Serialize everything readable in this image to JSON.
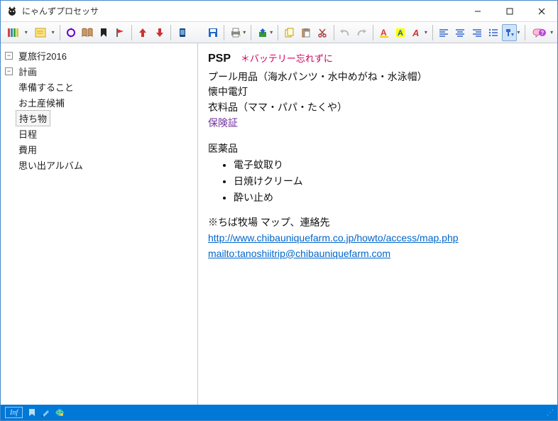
{
  "window": {
    "title": "にゃんずプロセッサ"
  },
  "tree": {
    "root": "夏旅行2016",
    "plan": "計画",
    "plan_children": [
      "準備すること",
      "お土産候補",
      "持ち物"
    ],
    "schedule": "日程",
    "cost": "費用",
    "album": "思い出アルバム",
    "selected": "持ち物"
  },
  "doc": {
    "psp": "PSP",
    "psp_note": "＊バッテリー忘れずに",
    "pool": "プール用品（海水パンツ・水中めがね・水泳帽）",
    "flash": "懐中電灯",
    "clothes": "衣料品（ママ・パパ・たくや）",
    "insurance": "保険証",
    "med_head": "医薬品",
    "med_items": [
      "電子蚊取り",
      "日焼けクリーム",
      "酔い止め"
    ],
    "note": "※ちば牧場 マップ、連絡先",
    "link1": "http://www.chibauniquefarm.co.jp/howto/access/map.php",
    "link2": "mailto:tanoshiitrip@chibauniquefarm.com"
  },
  "status": {
    "inf": "Inf"
  }
}
